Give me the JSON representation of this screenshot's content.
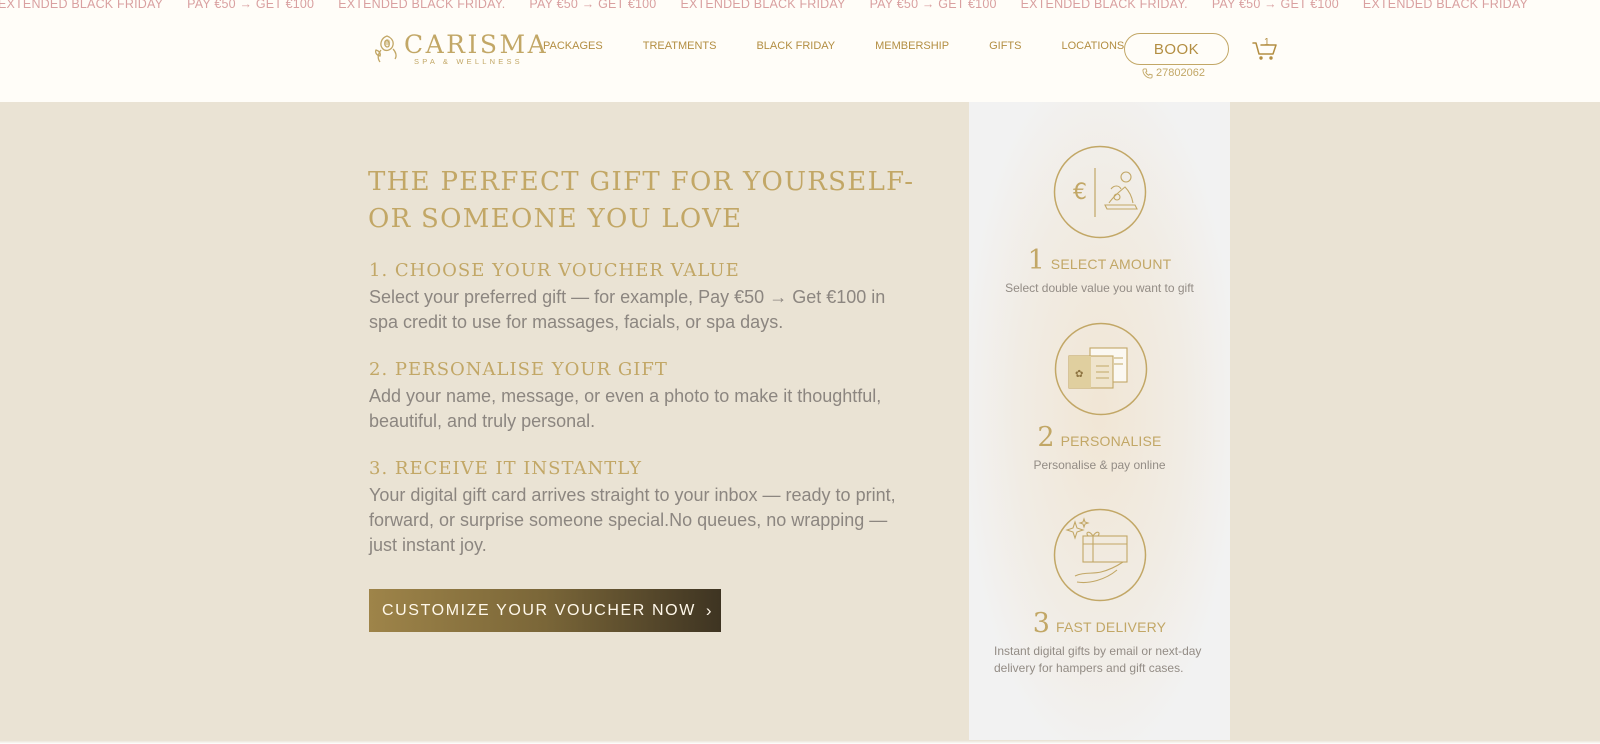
{
  "marquee": {
    "items": [
      "EXTENDED BLACK FRIDAY",
      "PAY €50 → GET €100",
      "EXTENDED BLACK FRIDAY.",
      "PAY €50 → GET €100",
      "EXTENDED BLACK FRIDAY",
      "PAY €50 → GET €100",
      "EXTENDED BLACK FRIDAY.",
      "PAY €50 → GET €100",
      "EXTENDED BLACK FRIDAY"
    ]
  },
  "header": {
    "logo_name": "CARISMA",
    "logo_tagline": "SPA & WELLNESS",
    "nav": [
      "PACKAGES",
      "TREATMENTS",
      "BLACK FRIDAY",
      "MEMBERSHIP",
      "GIFTS",
      "LOCATIONS"
    ],
    "book_label": "BOOK",
    "phone": "27802062",
    "cart_count": "1"
  },
  "main": {
    "headline": "THE PERFECT GIFT FOR YOURSELF-OR SOMEONE YOU LOVE",
    "steps": [
      {
        "title": "1. Choose your voucher value",
        "text": "Select your preferred gift — for example, Pay €50 → Get €100 in spa credit to use for massages, facials, or spa days."
      },
      {
        "title": "2. Personalise your gift",
        "text": "Add your name, message, or even a photo to make it thoughtful, beautiful, and truly personal."
      },
      {
        "title": "3. Receive it instantly",
        "text": "Your digital gift card arrives straight to your inbox — ready to print, forward, or surprise someone special.No queues, no wrapping — just instant joy."
      }
    ],
    "cta_label": "CUSTOMIZE YOUR VOUCHER NOW",
    "cta_arrow": "›"
  },
  "panel": {
    "features": [
      {
        "num": "1",
        "title": "SELECT AMOUNT",
        "desc": "Select double value you want to gift",
        "icon": "euro-massage-icon"
      },
      {
        "num": "2",
        "title": "PERSONALISE",
        "desc": "Personalise & pay online",
        "icon": "gift-cards-icon"
      },
      {
        "num": "3",
        "title": "FAST DELIVERY",
        "desc": "Instant digital gifts by email or next-day delivery for hampers and gift cases.",
        "icon": "hand-gift-icon"
      }
    ]
  },
  "colors": {
    "gold": "#c2a766",
    "nav_gold": "#b38e42",
    "background": "#eae3d4",
    "header_bg": "#fffdf8",
    "marquee_text": "#d9a0a0"
  }
}
